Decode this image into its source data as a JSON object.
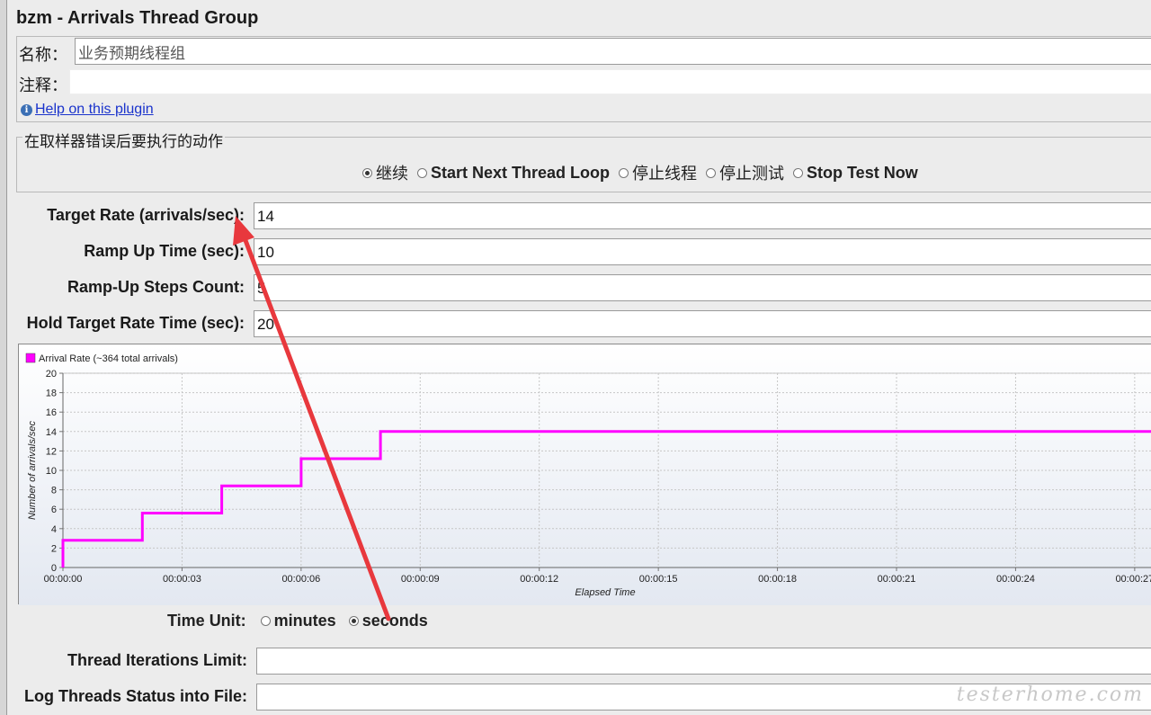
{
  "title": "bzm - Arrivals Thread Group",
  "name_label": "名称：",
  "name_value": "业务预期线程组",
  "comment_label": "注释：",
  "comment_value": "",
  "help_link": "Help on this plugin",
  "action_group": {
    "legend": "在取样器错误后要执行的动作",
    "options": [
      {
        "label": "继续",
        "selected": true
      },
      {
        "label": "Start Next Thread Loop",
        "selected": false
      },
      {
        "label": "停止线程",
        "selected": false
      },
      {
        "label": "停止测试",
        "selected": false
      },
      {
        "label": "Stop Test Now",
        "selected": false
      }
    ]
  },
  "fields": {
    "target_rate": {
      "label": "Target Rate (arrivals/sec):",
      "value": "14"
    },
    "ramp_up_time": {
      "label": "Ramp Up Time (sec):",
      "value": "10"
    },
    "ramp_up_steps": {
      "label": "Ramp-Up Steps Count:",
      "value": "5"
    },
    "hold_time": {
      "label": "Hold Target Rate Time (sec):",
      "value": "20"
    },
    "iterations_limit": {
      "label": "Thread Iterations Limit:",
      "value": ""
    },
    "log_file": {
      "label": "Log Threads Status into File:",
      "value": ""
    }
  },
  "time_unit": {
    "label": "Time Unit:",
    "options": [
      {
        "label": "minutes",
        "selected": false
      },
      {
        "label": "seconds",
        "selected": true
      }
    ]
  },
  "watermark": "testerhome.com",
  "colors": {
    "series": "#ff00ff",
    "annotation_arrow": "#e8383d"
  },
  "chart_data": {
    "type": "line",
    "step": true,
    "legend": "Arrival Rate (~364 total arrivals)",
    "xlabel": "Elapsed Time",
    "ylabel": "Number of arrivals/sec",
    "xlim": [
      0,
      28
    ],
    "ylim": [
      0,
      20
    ],
    "x_ticks": [
      0,
      3,
      6,
      9,
      12,
      15,
      18,
      21,
      24,
      27
    ],
    "x_tick_labels": [
      "00:00:00",
      "00:00:03",
      "00:00:06",
      "00:00:09",
      "00:00:12",
      "00:00:15",
      "00:00:18",
      "00:00:21",
      "00:00:24",
      "00:00:27"
    ],
    "y_ticks": [
      0,
      2,
      4,
      6,
      8,
      10,
      12,
      14,
      16,
      18,
      20
    ],
    "series": [
      {
        "name": "Arrival Rate (~364 total arrivals)",
        "points": [
          [
            0,
            0
          ],
          [
            0,
            2.8
          ],
          [
            2,
            2.8
          ],
          [
            2,
            5.6
          ],
          [
            4,
            5.6
          ],
          [
            4,
            8.4
          ],
          [
            6,
            8.4
          ],
          [
            6,
            11.2
          ],
          [
            8,
            11.2
          ],
          [
            8,
            14
          ],
          [
            28,
            14
          ]
        ]
      }
    ],
    "grid": true,
    "legend_position": "top-left"
  }
}
